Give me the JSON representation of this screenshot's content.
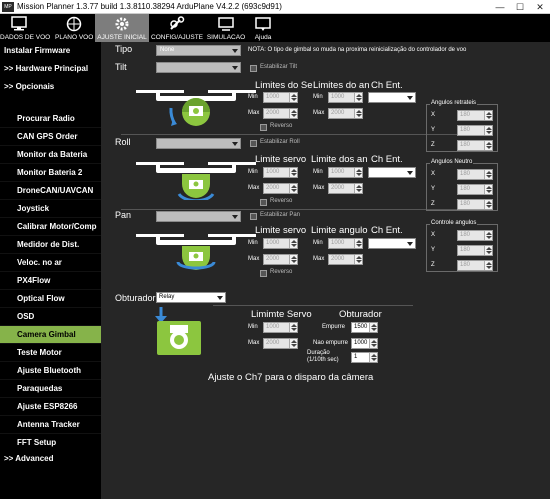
{
  "titlebar": {
    "app_icon": "MP",
    "title": "Mission Planner 1.3.77 build 1.3.8110.38294 ArduPlane V4.2.2 (693c9d91)",
    "minimize": "—",
    "maximize": "☐",
    "close": "✕"
  },
  "menu": {
    "items": [
      {
        "label": "DADOS DE VOO",
        "icon": "monitor-icon"
      },
      {
        "label": "PLANO VOO",
        "icon": "map-icon"
      },
      {
        "label": "AJUSTE INICIAL",
        "icon": "setup-icon"
      },
      {
        "label": "CONFIG/AJUSTE",
        "icon": "config-icon"
      },
      {
        "label": "SIMULACAO",
        "icon": "simulation-icon"
      },
      {
        "label": "Ajuda",
        "icon": "help-icon"
      }
    ],
    "active_index": 2
  },
  "sidebar": {
    "top_items": [
      "Instalar Firmware",
      ">> Hardware Principal",
      ">> Opcionais"
    ],
    "items": [
      "Procurar Radio",
      "CAN GPS Order",
      "Monitor da Bateria",
      "Monitor Bateria 2",
      "DroneCAN/UAVCAN",
      "Joystick",
      "Calibrar Motor/Comp",
      "Medidor de Dist.",
      "Veloc. no ar",
      "PX4Flow",
      "Optical Flow",
      "OSD",
      "Camera Gimbal",
      "Teste Motor",
      "Ajuste Bluetooth",
      "Paraquedas",
      "Ajuste ESP8266",
      "Antenna Tracker",
      "FFT Setup"
    ],
    "selected_item": "Camera Gimbal",
    "bottom_item": ">> Advanced"
  },
  "gimbal": {
    "tipo_label": "Tipo",
    "tipo_value": "None",
    "note": "NOTA: O tipo de gimbal so muda na proxima reinicialização do controlador de voo",
    "tilt": {
      "label": "Tilt",
      "stab_label": "Estabilizar Tilt",
      "servo_header": "Limites do Se",
      "angle_header": "Limites do an",
      "ch_header": "Ch Ent.",
      "min_label": "Min",
      "max_label": "Max",
      "servo_min": "1000",
      "servo_max": "2000",
      "angle_min": "1000",
      "angle_max": "2000",
      "reverse_label": "Reverso"
    },
    "roll": {
      "label": "Roll",
      "stab_label": "Estabilizar Roll",
      "servo_header": "Limite servo",
      "angle_header": "Limite dos an",
      "ch_header": "Ch Ent.",
      "min_label": "Min",
      "max_label": "Max",
      "servo_min": "1000",
      "servo_max": "2000",
      "angle_min": "1000",
      "angle_max": "2000",
      "reverse_label": "Reverso"
    },
    "pan": {
      "label": "Pan",
      "stab_label": "Estabilizar Pan",
      "servo_header": "Limite servo",
      "angle_header": "Limite angulo",
      "ch_header": "Ch Ent.",
      "min_label": "Min",
      "max_label": "Max",
      "servo_min": "1000",
      "servo_max": "2000",
      "angle_min": "1000",
      "angle_max": "2000",
      "reverse_label": "Reverso"
    },
    "retract": {
      "title": "Angulos retrateis",
      "x_label": "X",
      "y_label": "Y",
      "z_label": "Z",
      "x": "180",
      "y": "180",
      "z": "180"
    },
    "neutral": {
      "title": "Angulos Neutro",
      "x_label": "X",
      "y_label": "Y",
      "z_label": "Z",
      "x": "180",
      "y": "180",
      "z": "180"
    },
    "control": {
      "title": "Controle angulos",
      "x_label": "X",
      "y_label": "Y",
      "z_label": "Z",
      "x": "180",
      "y": "180",
      "z": "180"
    },
    "shutter": {
      "label": "Obturador",
      "value": "Relay",
      "servo_header": "Limimte Servo",
      "shutter_header": "Obturador",
      "min_label": "Min",
      "max_label": "Max",
      "servo_min": "1000",
      "servo_max": "2000",
      "push_label": "Empurre",
      "push_value": "1500",
      "nopush_label": "Nao empurre",
      "nopush_value": "1000",
      "duration_label": "Duração",
      "duration_unit": "(1/10th sec)",
      "duration_value": "1",
      "hint": "Ajuste o Ch7 para o disparo da câmera"
    }
  }
}
